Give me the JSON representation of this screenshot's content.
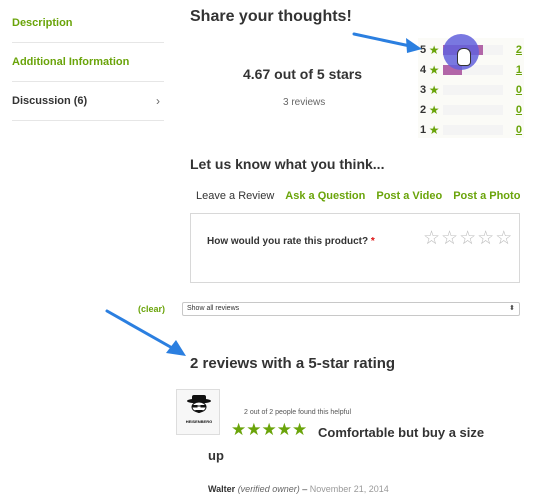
{
  "sidebar": {
    "items": [
      {
        "label": "Description"
      },
      {
        "label": "Additional Information"
      },
      {
        "label": "Discussion (6)",
        "chevron": "›"
      }
    ]
  },
  "summary": {
    "heading": "Share your thoughts!",
    "average": "4.67 out of 5 stars",
    "count": "3 reviews"
  },
  "distribution": [
    {
      "stars": "5",
      "count": "2",
      "fill": 0.67
    },
    {
      "stars": "4",
      "count": "1",
      "fill": 0.33
    },
    {
      "stars": "3",
      "count": "0",
      "fill": 0
    },
    {
      "stars": "2",
      "count": "0",
      "fill": 0
    },
    {
      "stars": "1",
      "count": "0",
      "fill": 0
    }
  ],
  "form": {
    "heading": "Let us know what you think...",
    "tabs": [
      "Leave a Review",
      "Ask a Question",
      "Post a Video",
      "Post a Photo"
    ],
    "question": "How would you rate this product?",
    "required": "*"
  },
  "filter": {
    "clear": "(clear)",
    "select_value": "Show all reviews"
  },
  "results": {
    "heading": "2 reviews with a 5-star rating"
  },
  "review": {
    "avatar_text": "HEISENBERG",
    "helpful": "2 out of 2 people found this helpful",
    "title_line1": "Comfortable but buy a size",
    "title_line2": "up",
    "author": "Walter",
    "verified": "(verified owner)",
    "dash": " – ",
    "date": "November 21, 2014"
  },
  "colors": {
    "accent": "#6aa40a",
    "bar": "#b266a8",
    "cursor": "#6260dc",
    "arrow": "#2b7fe0"
  }
}
